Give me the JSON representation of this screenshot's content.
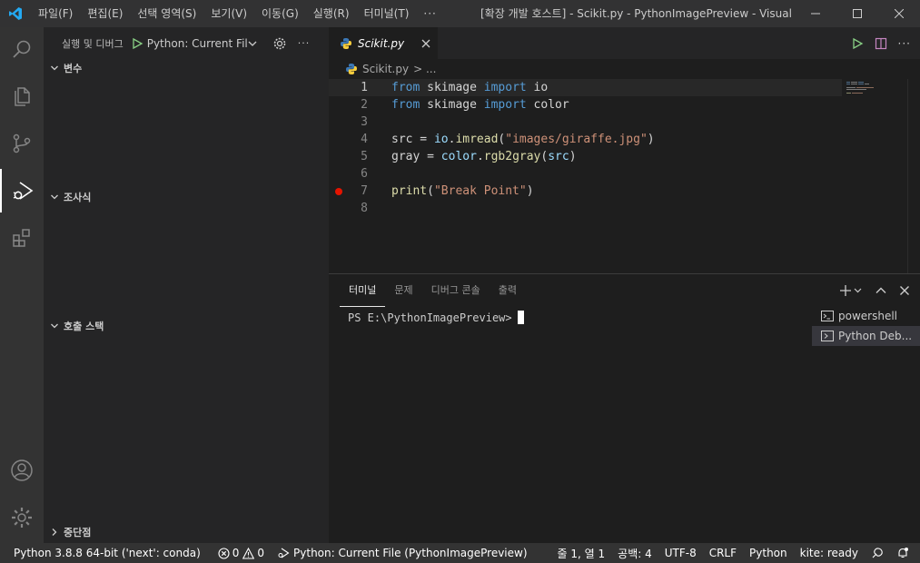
{
  "titlebar": {
    "menu": [
      "파일(F)",
      "편집(E)",
      "선택 영역(S)",
      "보기(V)",
      "이동(G)",
      "실행(R)",
      "터미널(T)"
    ],
    "more": "···",
    "title": "[확장 개발 호스트] - Scikit.py - PythonImagePreview - Visual St..."
  },
  "sidebar": {
    "title": "실행 및 디버그",
    "config": "Python: Current Fil",
    "sections": {
      "variables": "변수",
      "watch": "조사식",
      "callstack": "호출 스택",
      "breakpoints": "중단점"
    }
  },
  "editor": {
    "tab": "Scikit.py",
    "breadcrumb_file": "Scikit.py",
    "breadcrumb_rest": "> ...",
    "lines": [
      "1",
      "2",
      "3",
      "4",
      "5",
      "6",
      "7",
      "8"
    ],
    "code": {
      "l1": [
        "from",
        " skimage ",
        "import",
        " io"
      ],
      "l2": [
        "from",
        " skimage ",
        "import",
        " color"
      ],
      "l4": [
        "src",
        " = ",
        "io",
        ".",
        "imread",
        "(",
        "\"images/giraffe.jpg\"",
        ")"
      ],
      "l5": [
        "gray",
        " = ",
        "color",
        ".",
        "rgb2gray",
        "(",
        "src",
        ")"
      ],
      "l7": [
        "print",
        "(",
        "\"Break Point\"",
        ")"
      ]
    }
  },
  "panel": {
    "tabs": [
      "터미널",
      "문제",
      "디버그 콘솔",
      "출력"
    ],
    "prompt": "PS E:\\PythonImagePreview>",
    "terminals": [
      "powershell",
      "Python Deb..."
    ]
  },
  "statusbar": {
    "interpreter": "Python 3.8.8 64-bit ('next': conda)",
    "errors": "0",
    "warnings": "0",
    "debug_config": "Python: Current File (PythonImagePreview)",
    "position": "줄 1, 열 1",
    "spaces": "공백: 4",
    "encoding": "UTF-8",
    "eol": "CRLF",
    "language": "Python",
    "kite": "kite: ready"
  }
}
